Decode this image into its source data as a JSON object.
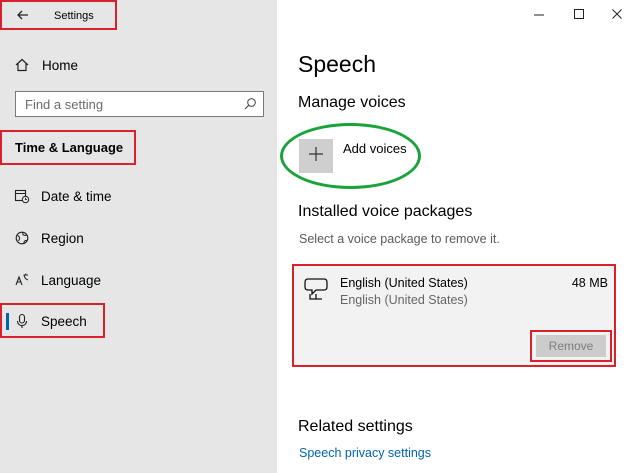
{
  "window": {
    "title": "Settings"
  },
  "sidebar": {
    "home_label": "Home",
    "search_placeholder": "Find a setting",
    "section_title": "Time & Language",
    "items": [
      {
        "label": "Date & time",
        "icon": "date-time-icon"
      },
      {
        "label": "Region",
        "icon": "globe-icon"
      },
      {
        "label": "Language",
        "icon": "language-icon"
      },
      {
        "label": "Speech",
        "icon": "microphone-icon",
        "selected": true
      }
    ],
    "accent_color": "#0063b1"
  },
  "main": {
    "title": "Speech",
    "manage_voices": "Manage voices",
    "add_voices_label": "Add voices",
    "installed_heading": "Installed voice packages",
    "installed_hint": "Select a voice package to remove it.",
    "package": {
      "name": "English (United States)",
      "subtitle": "English (United States)",
      "size": "48 MB",
      "remove_label": "Remove"
    },
    "related_heading": "Related settings",
    "privacy_link": "Speech privacy settings"
  },
  "colors": {
    "highlight_red": "#d9202b",
    "highlight_green": "#1aa33a",
    "link_blue": "#0063b1"
  }
}
